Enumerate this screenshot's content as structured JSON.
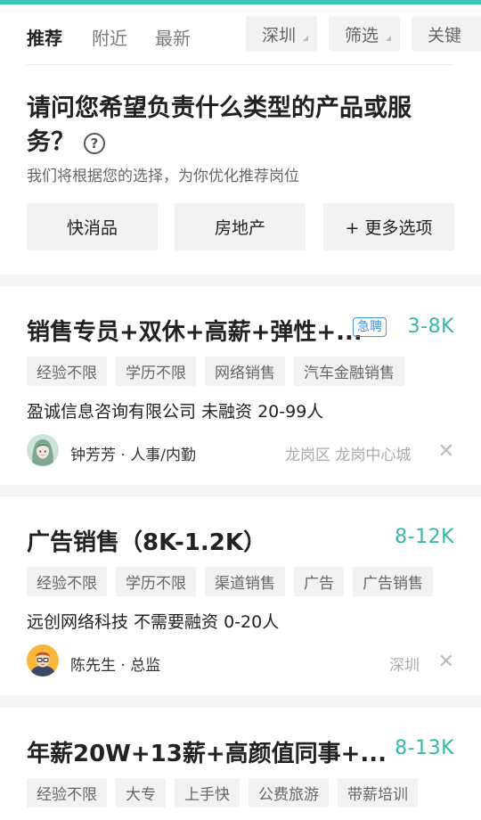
{
  "header": {
    "tabs": [
      {
        "label": "推荐",
        "active": true
      },
      {
        "label": "附近",
        "active": false
      },
      {
        "label": "最新",
        "active": false
      }
    ],
    "filters": [
      {
        "label": "深圳"
      },
      {
        "label": "筛选"
      },
      {
        "label": "关键"
      }
    ]
  },
  "preference": {
    "question": "请问您希望负责什么类型的产品或服务？",
    "help_icon": "question-circle-icon",
    "subtitle": "我们将根据您的选择，为你优化推荐岗位",
    "options": [
      "快消品",
      "房地产",
      "+ 更多选项"
    ]
  },
  "jobs": [
    {
      "title": "销售专员+双休+高薪+弹性+...",
      "urgent_badge": "急聘",
      "salary": "3-8K",
      "tags": [
        "经验不限",
        "学历不限",
        "网络销售",
        "汽车金融销售"
      ],
      "company": "盈诚信息咨询有限公司  未融资  20-99人",
      "recruiter": "钟芳芳 · 人事/内勤",
      "location": "龙岗区  龙岗中心城"
    },
    {
      "title": "广告销售（8K-1.2K）",
      "salary": "8-12K",
      "tags": [
        "经验不限",
        "学历不限",
        "渠道销售",
        "广告",
        "广告销售"
      ],
      "company": "远创网络科技  不需要融资  0-20人",
      "recruiter": "陈先生 · 总监",
      "location": "深圳"
    },
    {
      "title": "年薪20W+13薪+高颜值同事+...",
      "salary": "8-13K",
      "tags": [
        "经验不限",
        "大专",
        "上手快",
        "公费旅游",
        "带薪培训"
      ]
    }
  ],
  "colors": {
    "accent": "#36c8b4",
    "salary": "#36b8a8",
    "urgent": "#4a90e2"
  }
}
